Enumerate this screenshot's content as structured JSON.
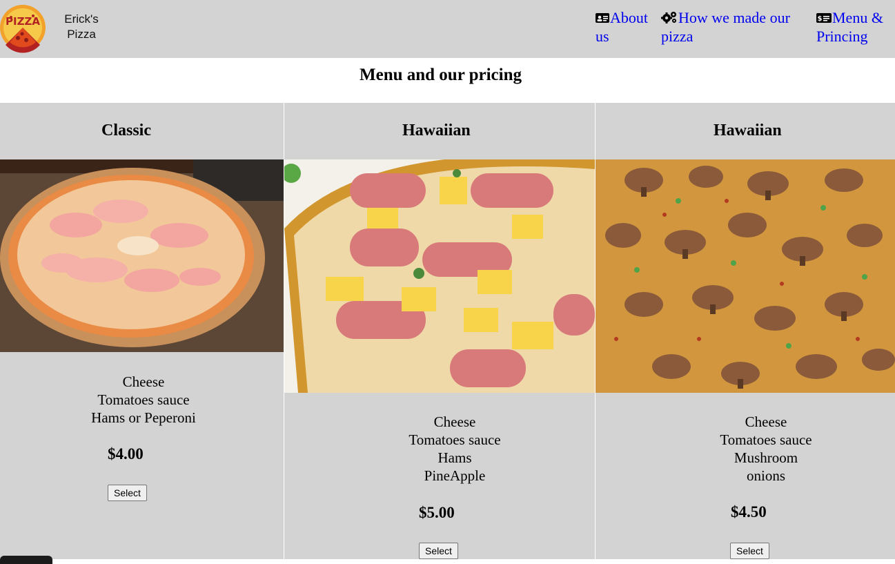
{
  "brand": {
    "name_line1": "Erick's",
    "name_line2": "Pizza",
    "logo_text": "PIZZA"
  },
  "nav": {
    "about": {
      "label_line1": "About",
      "label_line2": "us",
      "icon": "id-card-icon"
    },
    "how": {
      "label_line1": "How we made our",
      "label_line2": "pizza",
      "icon": "gears-icon"
    },
    "menu": {
      "label_line1": "Menu &",
      "label_line2": "Princing",
      "icon": "money-bill-icon"
    }
  },
  "page_title": "Menu and our pricing",
  "menu": [
    {
      "title": "Classic",
      "ingredients": [
        "Cheese",
        "Tomatoes sauce",
        "Hams or Peperoni"
      ],
      "price": "$4.00",
      "button": "Select"
    },
    {
      "title": "Hawaiian",
      "ingredients": [
        "Cheese",
        "Tomatoes sauce",
        "Hams",
        "PineApple"
      ],
      "price": "$5.00",
      "button": "Select"
    },
    {
      "title": "Hawaiian",
      "ingredients": [
        "Cheese",
        "Tomatoes sauce",
        "Mushroom",
        "onions"
      ],
      "price": "$4.50",
      "button": "Select"
    }
  ],
  "colors": {
    "panel": "#d3d3d3",
    "link": "#0000ee",
    "background": "#ffffff"
  }
}
